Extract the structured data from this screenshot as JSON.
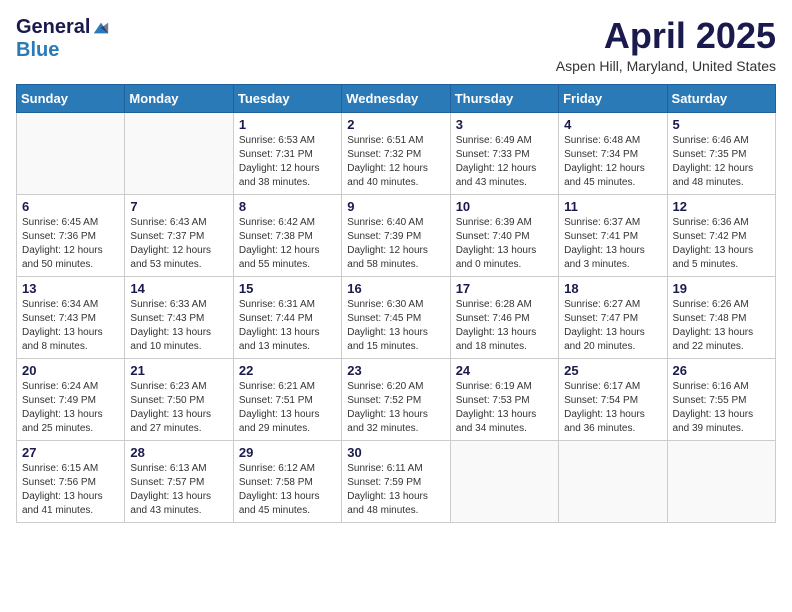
{
  "logo": {
    "general": "General",
    "blue": "Blue"
  },
  "title": "April 2025",
  "location": "Aspen Hill, Maryland, United States",
  "days_of_week": [
    "Sunday",
    "Monday",
    "Tuesday",
    "Wednesday",
    "Thursday",
    "Friday",
    "Saturday"
  ],
  "weeks": [
    [
      {
        "day": "",
        "info": ""
      },
      {
        "day": "",
        "info": ""
      },
      {
        "day": "1",
        "info": "Sunrise: 6:53 AM\nSunset: 7:31 PM\nDaylight: 12 hours and 38 minutes."
      },
      {
        "day": "2",
        "info": "Sunrise: 6:51 AM\nSunset: 7:32 PM\nDaylight: 12 hours and 40 minutes."
      },
      {
        "day": "3",
        "info": "Sunrise: 6:49 AM\nSunset: 7:33 PM\nDaylight: 12 hours and 43 minutes."
      },
      {
        "day": "4",
        "info": "Sunrise: 6:48 AM\nSunset: 7:34 PM\nDaylight: 12 hours and 45 minutes."
      },
      {
        "day": "5",
        "info": "Sunrise: 6:46 AM\nSunset: 7:35 PM\nDaylight: 12 hours and 48 minutes."
      }
    ],
    [
      {
        "day": "6",
        "info": "Sunrise: 6:45 AM\nSunset: 7:36 PM\nDaylight: 12 hours and 50 minutes."
      },
      {
        "day": "7",
        "info": "Sunrise: 6:43 AM\nSunset: 7:37 PM\nDaylight: 12 hours and 53 minutes."
      },
      {
        "day": "8",
        "info": "Sunrise: 6:42 AM\nSunset: 7:38 PM\nDaylight: 12 hours and 55 minutes."
      },
      {
        "day": "9",
        "info": "Sunrise: 6:40 AM\nSunset: 7:39 PM\nDaylight: 12 hours and 58 minutes."
      },
      {
        "day": "10",
        "info": "Sunrise: 6:39 AM\nSunset: 7:40 PM\nDaylight: 13 hours and 0 minutes."
      },
      {
        "day": "11",
        "info": "Sunrise: 6:37 AM\nSunset: 7:41 PM\nDaylight: 13 hours and 3 minutes."
      },
      {
        "day": "12",
        "info": "Sunrise: 6:36 AM\nSunset: 7:42 PM\nDaylight: 13 hours and 5 minutes."
      }
    ],
    [
      {
        "day": "13",
        "info": "Sunrise: 6:34 AM\nSunset: 7:43 PM\nDaylight: 13 hours and 8 minutes."
      },
      {
        "day": "14",
        "info": "Sunrise: 6:33 AM\nSunset: 7:43 PM\nDaylight: 13 hours and 10 minutes."
      },
      {
        "day": "15",
        "info": "Sunrise: 6:31 AM\nSunset: 7:44 PM\nDaylight: 13 hours and 13 minutes."
      },
      {
        "day": "16",
        "info": "Sunrise: 6:30 AM\nSunset: 7:45 PM\nDaylight: 13 hours and 15 minutes."
      },
      {
        "day": "17",
        "info": "Sunrise: 6:28 AM\nSunset: 7:46 PM\nDaylight: 13 hours and 18 minutes."
      },
      {
        "day": "18",
        "info": "Sunrise: 6:27 AM\nSunset: 7:47 PM\nDaylight: 13 hours and 20 minutes."
      },
      {
        "day": "19",
        "info": "Sunrise: 6:26 AM\nSunset: 7:48 PM\nDaylight: 13 hours and 22 minutes."
      }
    ],
    [
      {
        "day": "20",
        "info": "Sunrise: 6:24 AM\nSunset: 7:49 PM\nDaylight: 13 hours and 25 minutes."
      },
      {
        "day": "21",
        "info": "Sunrise: 6:23 AM\nSunset: 7:50 PM\nDaylight: 13 hours and 27 minutes."
      },
      {
        "day": "22",
        "info": "Sunrise: 6:21 AM\nSunset: 7:51 PM\nDaylight: 13 hours and 29 minutes."
      },
      {
        "day": "23",
        "info": "Sunrise: 6:20 AM\nSunset: 7:52 PM\nDaylight: 13 hours and 32 minutes."
      },
      {
        "day": "24",
        "info": "Sunrise: 6:19 AM\nSunset: 7:53 PM\nDaylight: 13 hours and 34 minutes."
      },
      {
        "day": "25",
        "info": "Sunrise: 6:17 AM\nSunset: 7:54 PM\nDaylight: 13 hours and 36 minutes."
      },
      {
        "day": "26",
        "info": "Sunrise: 6:16 AM\nSunset: 7:55 PM\nDaylight: 13 hours and 39 minutes."
      }
    ],
    [
      {
        "day": "27",
        "info": "Sunrise: 6:15 AM\nSunset: 7:56 PM\nDaylight: 13 hours and 41 minutes."
      },
      {
        "day": "28",
        "info": "Sunrise: 6:13 AM\nSunset: 7:57 PM\nDaylight: 13 hours and 43 minutes."
      },
      {
        "day": "29",
        "info": "Sunrise: 6:12 AM\nSunset: 7:58 PM\nDaylight: 13 hours and 45 minutes."
      },
      {
        "day": "30",
        "info": "Sunrise: 6:11 AM\nSunset: 7:59 PM\nDaylight: 13 hours and 48 minutes."
      },
      {
        "day": "",
        "info": ""
      },
      {
        "day": "",
        "info": ""
      },
      {
        "day": "",
        "info": ""
      }
    ]
  ]
}
